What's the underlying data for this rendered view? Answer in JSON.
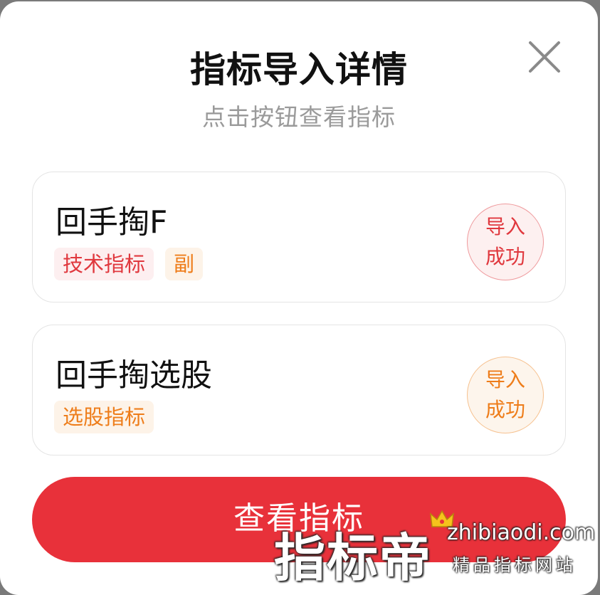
{
  "modal": {
    "title": "指标导入详情",
    "subtitle": "点击按钮查看指标",
    "close_icon": "close-icon"
  },
  "cards": [
    {
      "name": "回手掏F",
      "tags": [
        {
          "label": "技术指标",
          "color": "#e0383e"
        },
        {
          "label": "副",
          "color": "#ee7d1a"
        }
      ],
      "status": {
        "line1": "导入",
        "line2": "成功",
        "color": "#e0383e"
      }
    },
    {
      "name": "回手掏选股",
      "tags": [
        {
          "label": "选股指标",
          "color": "#ee7d1a"
        }
      ],
      "status": {
        "line1": "导入",
        "line2": "成功",
        "color": "#ee7d1a"
      }
    }
  ],
  "primary_button": {
    "label": "查看指标",
    "color": "#e8313a"
  },
  "watermark": {
    "brand": "指标帝",
    "domain": "zhibiaodi.com",
    "slogan": "精品指标网站",
    "icon": "crown-icon"
  }
}
